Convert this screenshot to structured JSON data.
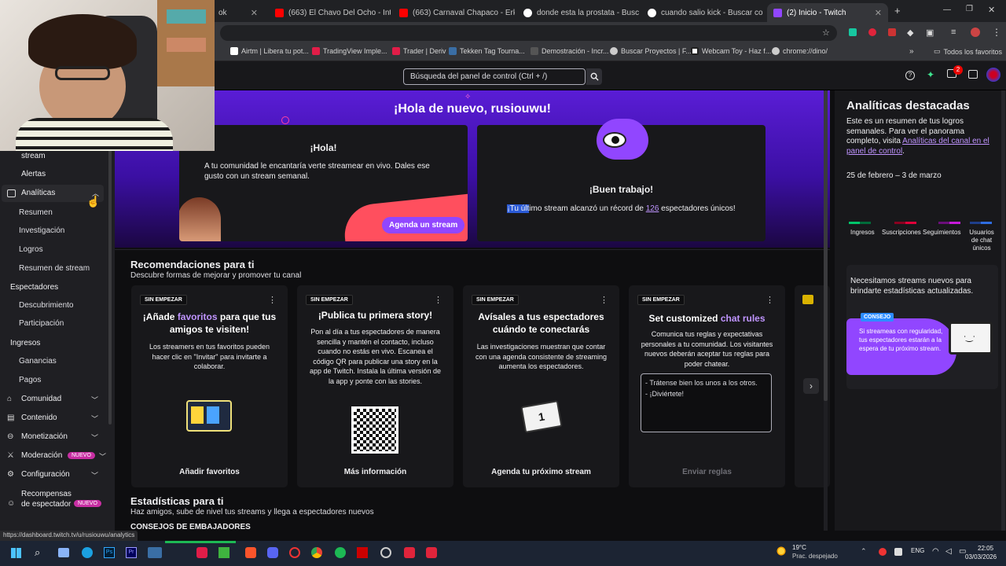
{
  "browser": {
    "tabs": [
      {
        "title": "ok",
        "active": false,
        "color": "#888888"
      },
      {
        "title": "(663) El Chavo Del Ocho - Intro",
        "active": false,
        "color": "#ff0000"
      },
      {
        "title": "(663) Carnaval Chapaco - Erke",
        "active": false,
        "color": "#ff0000"
      },
      {
        "title": "donde esta la prostata - Buscar",
        "active": false,
        "color": "#ffffff"
      },
      {
        "title": "cuando salio kick - Buscar con",
        "active": false,
        "color": "#ffffff"
      },
      {
        "title": "(2) Inicio - Twitch",
        "active": true,
        "color": "#9146ff"
      }
    ],
    "bookmarks": [
      {
        "label": "Airtm | Libera tu pot...",
        "color": "#ffffff"
      },
      {
        "label": "TradingView Imple...",
        "color": "#e11d48"
      },
      {
        "label": "Trader | Deriv",
        "color": "#e11d48"
      },
      {
        "label": "Tekken Tag Tourna...",
        "color": "#3a6ea5"
      },
      {
        "label": "Demostración - Incr...",
        "color": "#555555"
      },
      {
        "label": "Buscar Proyectos | F...",
        "color": "#cccccc"
      },
      {
        "label": "Webcam Toy - Haz f...",
        "color": "#222222"
      },
      {
        "label": "chrome://dino/",
        "color": "#cccccc"
      }
    ],
    "bookmarks_all": "Todos los favoritos",
    "status_url": "https://dashboard.twitch.tv/u/rusiouwu/analytics"
  },
  "topnav": {
    "search_placeholder": "Búsqueda del panel de control (Ctrl + /)",
    "notif_count": "2"
  },
  "sidebar": {
    "stream_label": "stream",
    "alertas": "Alertas",
    "analiticas": "Analíticas",
    "resumen": "Resumen",
    "investigacion": "Investigación",
    "logros": "Logros",
    "resumen_stream": "Resumen de stream",
    "espectadores": "Espectadores",
    "descubrimiento": "Descubrimiento",
    "participacion": "Participación",
    "ingresos": "Ingresos",
    "ganancias": "Ganancias",
    "pagos": "Pagos",
    "comunidad": "Comunidad",
    "contenido": "Contenido",
    "monetizacion": "Monetización",
    "moderacion": "Moderación",
    "moderacion_badge": "NUEVO",
    "configuracion": "Configuración",
    "recompensas": "Recompensas de espectador",
    "recompensas_badge": "NUEVO"
  },
  "hero": {
    "title": "¡Hola de nuevo, rusiouwu!",
    "card1_title": "¡Hola!",
    "card1_text": "A tu comunidad le encantaría verte streamear en vivo. Dales ese gusto con un stream semanal.",
    "card1_button": "Agenda un stream",
    "card2_title": "¡Buen trabajo!",
    "card2_text_pre": "¡Tu último stream alcanzó un récord de ",
    "card2_number": "126",
    "card2_text_post": " espectadores únicos!"
  },
  "recommendations": {
    "title": "Recomendaciones para ti",
    "subtitle": "Descubre formas de mejorar y promover tu canal",
    "cards": [
      {
        "pill": "SIN EMPEZAR",
        "title_pre": "¡Añade ",
        "title_accent": "favoritos",
        "title_post": " para que tus amigos te visiten!",
        "text": "Los streamers en tus favoritos pueden hacer clic en \"Invitar\" para invitarte a colaborar.",
        "button": "Añadir favoritos"
      },
      {
        "pill": "SIN EMPEZAR",
        "title_pre": "¡Publica tu primera story!",
        "title_accent": "",
        "title_post": "",
        "text": "Pon al día a tus espectadores de manera sencilla y mantén el contacto, incluso cuando no estás en vivo. Escanea el código QR para publicar una story en la app de Twitch. Instala la última versión de la app y ponte con las stories.",
        "button": "Más información"
      },
      {
        "pill": "SIN EMPEZAR",
        "title_pre": "Avísales a tus espectadores cuándo te conectarás",
        "title_accent": "",
        "title_post": "",
        "text": "Las investigaciones muestran que contar con una agenda consistente de streaming aumenta los espectadores.",
        "button": "Agenda tu próximo stream"
      },
      {
        "pill": "SIN EMPEZAR",
        "title_pre": "Set customized ",
        "title_accent": "chat rules",
        "title_post": "",
        "text": "Comunica tus reglas y expectativas personales a tu comunidad. Los visitantes nuevos deberán aceptar tus reglas para poder chatear.",
        "rules_text": "- Trátense bien los unos a los otros.\n- ¡Diviértete!",
        "button": "Enviar reglas"
      }
    ]
  },
  "stats": {
    "title": "Estadísticas para ti",
    "subtitle": "Haz amigos, sube de nivel tus streams y llega a espectadores nuevos",
    "section": "CONSEJOS DE EMBAJADORES"
  },
  "right_panel": {
    "title": "Analíticas destacadas",
    "text": "Este es un resumen de tus logros semanales. Para ver el panorama completo, visita ",
    "link": "Analíticas del canal en el panel de control",
    "link_end": ".",
    "date_range": "25 de febrero – 3 de marzo",
    "legend": [
      {
        "label": "Ingresos",
        "color": "#00c46a"
      },
      {
        "label": "Suscripciones",
        "color": "#e0003a"
      },
      {
        "label": "Seguimientos",
        "color": "#c61ad9"
      },
      {
        "label": "Usuarios de chat únicos",
        "color": "#2f6de0"
      }
    ],
    "promo_text": "Necesitamos streams nuevos para brindarte estadísticas actualizadas.",
    "tip_label": "CONSEJO",
    "tip_text": "Si streameas con regularidad, tus espectadores estarán a la espera de tu próximo stream."
  },
  "taskbar": {
    "weather_temp": "19°C",
    "weather_desc": "Prac. despejado",
    "lang": "ENG",
    "time": "22:05",
    "date": "03/03/2026"
  }
}
